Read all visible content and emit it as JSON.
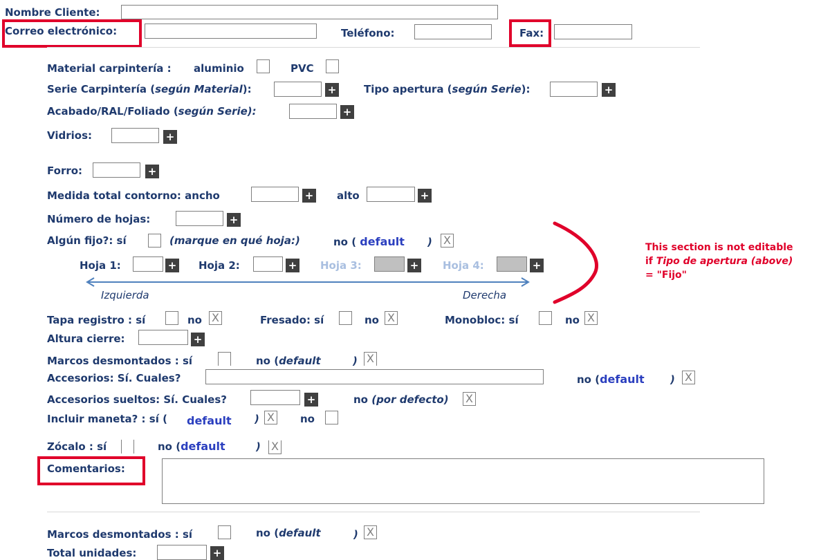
{
  "client": {
    "nombre_label": "Nombre Cliente:",
    "correo_label": "Correo electrónico:",
    "telefono_label": "Teléfono:",
    "fax_label": "Fax:"
  },
  "material": {
    "label": "Material carpintería :",
    "aluminio": "aluminio",
    "pvc": "PVC"
  },
  "serie": {
    "label_a": "Serie Carpintería (",
    "label_it": "según Material",
    "label_b": "):"
  },
  "tipo_apertura": {
    "label_a": "Tipo apertura (",
    "label_it": "según Serie",
    "label_b": "):"
  },
  "acabado": {
    "label_a": "Acabado/RAL/Foliado (",
    "label_it": "según Serie):"
  },
  "vidrios": {
    "label": "Vidrios:"
  },
  "forro": {
    "label": "Forro:"
  },
  "medida": {
    "label": "Medida total contorno:  ancho",
    "alto": "alto"
  },
  "hojas": {
    "label": "Número de hojas:"
  },
  "fijo": {
    "label": "Algún fijo?:  sí",
    "marque": "(marque en qué hoja:)",
    "no": "no (",
    "default": "default",
    "close": ")"
  },
  "hoja_labels": {
    "h1": "Hoja  1:",
    "h2": "Hoja  2:",
    "h3": "Hoja  3:",
    "h4": "Hoja  4:"
  },
  "direction": {
    "left": "Izquierda",
    "right": "Derecha"
  },
  "note": {
    "line1": "This section is not editable",
    "line2_a": "if ",
    "line2_it": "Tipo de apertura (above)",
    "line3": "= \"Fijo\""
  },
  "tapa": {
    "label": "Tapa registro :  sí",
    "no": "no"
  },
  "fresado": {
    "label": "Fresado: sí",
    "no": "no"
  },
  "monobloc": {
    "label": "Monobloc: sí",
    "no": "no"
  },
  "altura": {
    "label": "Altura cierre:"
  },
  "marcos": {
    "label": "Marcos desmontados :  sí",
    "no": "no (",
    "default": "default",
    "close": ")"
  },
  "accesorios": {
    "label": "Accesorios:  Sí. Cuales?",
    "no": "no (",
    "default": "default",
    "close": ")"
  },
  "sueltos": {
    "label": "Accesorios sueltos:  Sí. Cuales?",
    "no": "no",
    "por_defecto": "(por defecto)"
  },
  "maneta": {
    "label": "Incluir maneta? :  sí (",
    "default": "default",
    "close": ")",
    "no": "no"
  },
  "zocalo": {
    "label": "Zócalo :  sí",
    "no": "no (",
    "default": "default",
    "close": ")"
  },
  "comentarios": {
    "label": "Comentarios:"
  },
  "marcos2": {
    "label": "Marcos desmontados :  sí",
    "no": "no (",
    "default": "default",
    "close": ")"
  },
  "total": {
    "label": "Total unidades:"
  },
  "symbols": {
    "plus": "+",
    "x": "X"
  }
}
